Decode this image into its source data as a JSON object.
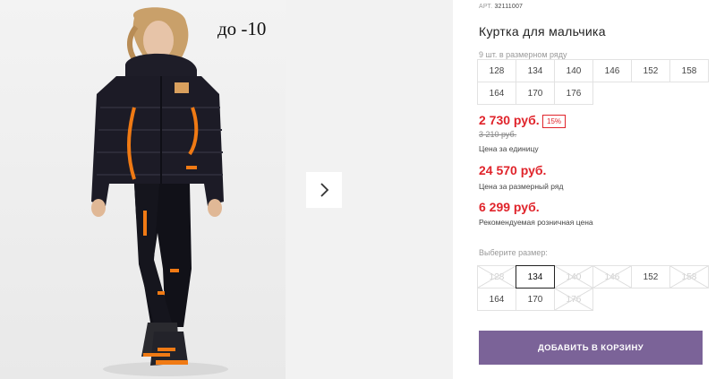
{
  "gallery": {
    "badge": "до -10",
    "next_icon": "chevron-right-icon"
  },
  "product": {
    "art_label": "АРТ.",
    "art_value": "32111007",
    "title": "Куртка для мальчика",
    "sizes_note": "9 шт. в размерном ряду",
    "size_row": [
      "128",
      "134",
      "140",
      "146",
      "152",
      "158",
      "164",
      "170",
      "176"
    ],
    "price": "2 730 руб.",
    "discount": "15%",
    "old_price": "3 210 руб.",
    "unit_label": "Цена за единицу",
    "row_price": "24 570 руб.",
    "row_label": "Цена за размерный ряд",
    "retail_price": "6 299 руб.",
    "retail_label": "Рекомендуемая розничная цена"
  },
  "size_picker": {
    "label": "Выберите размер:",
    "options": [
      {
        "size": "128",
        "state": "disabled"
      },
      {
        "size": "134",
        "state": "selected"
      },
      {
        "size": "140",
        "state": "disabled"
      },
      {
        "size": "146",
        "state": "disabled"
      },
      {
        "size": "152",
        "state": "available"
      },
      {
        "size": "158",
        "state": "disabled"
      },
      {
        "size": "164",
        "state": "available"
      },
      {
        "size": "170",
        "state": "available"
      },
      {
        "size": "176",
        "state": "disabled"
      }
    ]
  },
  "cart": {
    "button_label": "ДОБАВИТЬ В КОРЗИНУ"
  },
  "colors": {
    "accent": "#7b6398",
    "price_red": "#e0242b",
    "jacket": "#1c1b26",
    "trim_orange": "#f07a14"
  }
}
